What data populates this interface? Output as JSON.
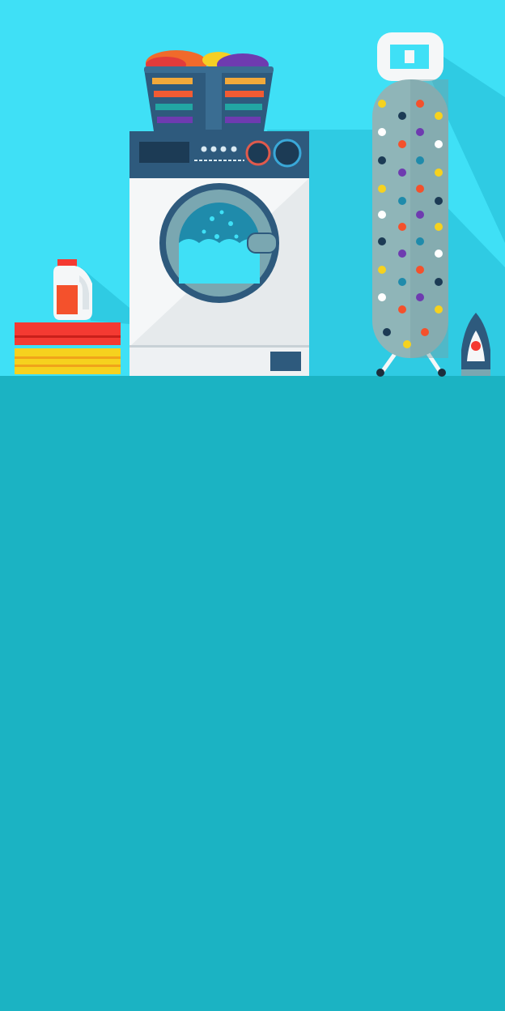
{
  "scene": {
    "description_visible_text": "",
    "colors": {
      "wall": "#3fe0f6",
      "floor": "#1bb3c3",
      "shadow": "#2ec9e0",
      "machine_panel": "#2e5a7d",
      "machine_body": "#f5f7f8",
      "board": "#8fb5b8",
      "accent_red": "#f43a32",
      "accent_yellow": "#f6d21e"
    },
    "icons": [
      "laundry-basket-icon",
      "washing-machine-icon",
      "detergent-bottle-icon",
      "folded-towels-icon",
      "ironing-board-icon",
      "clothes-iron-icon"
    ]
  }
}
